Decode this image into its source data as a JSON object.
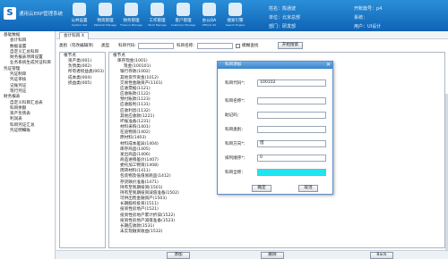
{
  "app": {
    "logo_glyph": "S",
    "title": "通用云ERP管理系统"
  },
  "nav": [
    {
      "label": "公共设置",
      "sub": "System Set"
    },
    {
      "label": "物资管理",
      "sub": "Material Manage"
    },
    {
      "label": "财务管理",
      "sub": "Finance Manage"
    },
    {
      "label": "工作管理",
      "sub": "Work Manage"
    },
    {
      "label": "客户管理",
      "sub": "Customer Manage"
    },
    {
      "label": "办公OA",
      "sub": "Official OA"
    },
    {
      "label": "搜索引擎",
      "sub": "Search Engine"
    }
  ],
  "user_info": {
    "name_label": "姓名：",
    "name": "陈通波",
    "company_label": "单位：",
    "company": "北京总部",
    "dept_label": "部门：",
    "dept": "研发部",
    "account_label": "开账篇号：",
    "account": "p4",
    "system_label": "系统：",
    "user_label": "用户：",
    "user": "UI设计"
  },
  "sidebar": [
    {
      "text": "基础数据",
      "level": 0
    },
    {
      "text": "会计科目",
      "level": 1
    },
    {
      "text": "数据设置",
      "level": 1
    },
    {
      "text": "自定义汇总科目",
      "level": 1
    },
    {
      "text": "财务报表项目设置",
      "level": 1
    },
    {
      "text": "业务系统生成凭证科目",
      "level": 1
    },
    {
      "text": "凭证管理",
      "level": 0
    },
    {
      "text": "凭证制单",
      "level": 1
    },
    {
      "text": "凭证审核",
      "level": 1
    },
    {
      "text": "记账凭证",
      "level": 1
    },
    {
      "text": "现行凭证",
      "level": 1
    },
    {
      "text": "财务报表",
      "level": 0
    },
    {
      "text": "自定义科目汇总表",
      "level": 1
    },
    {
      "text": "科目余额",
      "level": 1
    },
    {
      "text": "资产负债表",
      "level": 1
    },
    {
      "text": "利润表",
      "level": 1
    },
    {
      "text": "科目凭证汇总",
      "level": 1
    },
    {
      "text": "凭证明细账",
      "level": 1
    }
  ],
  "tab": {
    "label": "会计科目 X"
  },
  "toolbar": {
    "category_label": "类别（勿改编辑项）",
    "type_label": "类型",
    "code_label": "科目代码:",
    "name_label": "科目名称:",
    "check_label": "模糊查找",
    "search_button": "开始搜索"
  },
  "category_tree": [
    "根节点",
    "资产类(001)",
    "负债类(002)",
    "所有者权益类(003)",
    "成本类(004)",
    "损益类(005)"
  ],
  "subject_tree": [
    "根节点",
    "库存现金(1001)",
    "现金(100101)",
    "银行存款(1002)",
    "其他货币资金(1012)",
    "交易性金融资产(1101)",
    "应收票据(1121)",
    "应收账款(1122)",
    "预付账款(1123)",
    "应收股利(1131)",
    "应收利息(1132)",
    "其他应收款(1221)",
    "坏账准备(1231)",
    "材料采购(1401)",
    "在途物资(1402)",
    "原材料(1403)",
    "材料成本差异(1404)",
    "库存商品(1405)",
    "发出商品(1406)",
    "商品进销差价(1407)",
    "委托加工物资(1408)",
    "周转材料(1411)",
    "包装物及低值易耗品(1412)",
    "存货跌价准备(1471)",
    "持有至到期投资(1501)",
    "持有至到期投资减值准备(1502)",
    "可供出售金融资产(1503)",
    "长期股权投资(1511)",
    "投资性房地产(1521)",
    "投资性房地产累计折旧(1522)",
    "投资性房地产减值准备(1523)",
    "长期应收款(1531)",
    "未实现融资收益(1532)"
  ],
  "bottom": {
    "add": "添加",
    "delete": "删除",
    "back": "Back"
  },
  "dialog": {
    "title": "科目添加",
    "close": "✕",
    "fields": [
      {
        "label": "科目代码*：",
        "value": "100102"
      },
      {
        "label": "科目名称*：",
        "value": ""
      },
      {
        "label": "助记码：",
        "value": ""
      },
      {
        "label": "科目类别：",
        "value": ""
      },
      {
        "label": "科目方向*：",
        "value": "借"
      },
      {
        "label": "排列顺序*：",
        "value": "0"
      },
      {
        "label": "科目全称：",
        "value": ""
      }
    ],
    "ok": "确定",
    "cancel": "取消",
    "highlight_color": "#1ee6f0"
  }
}
